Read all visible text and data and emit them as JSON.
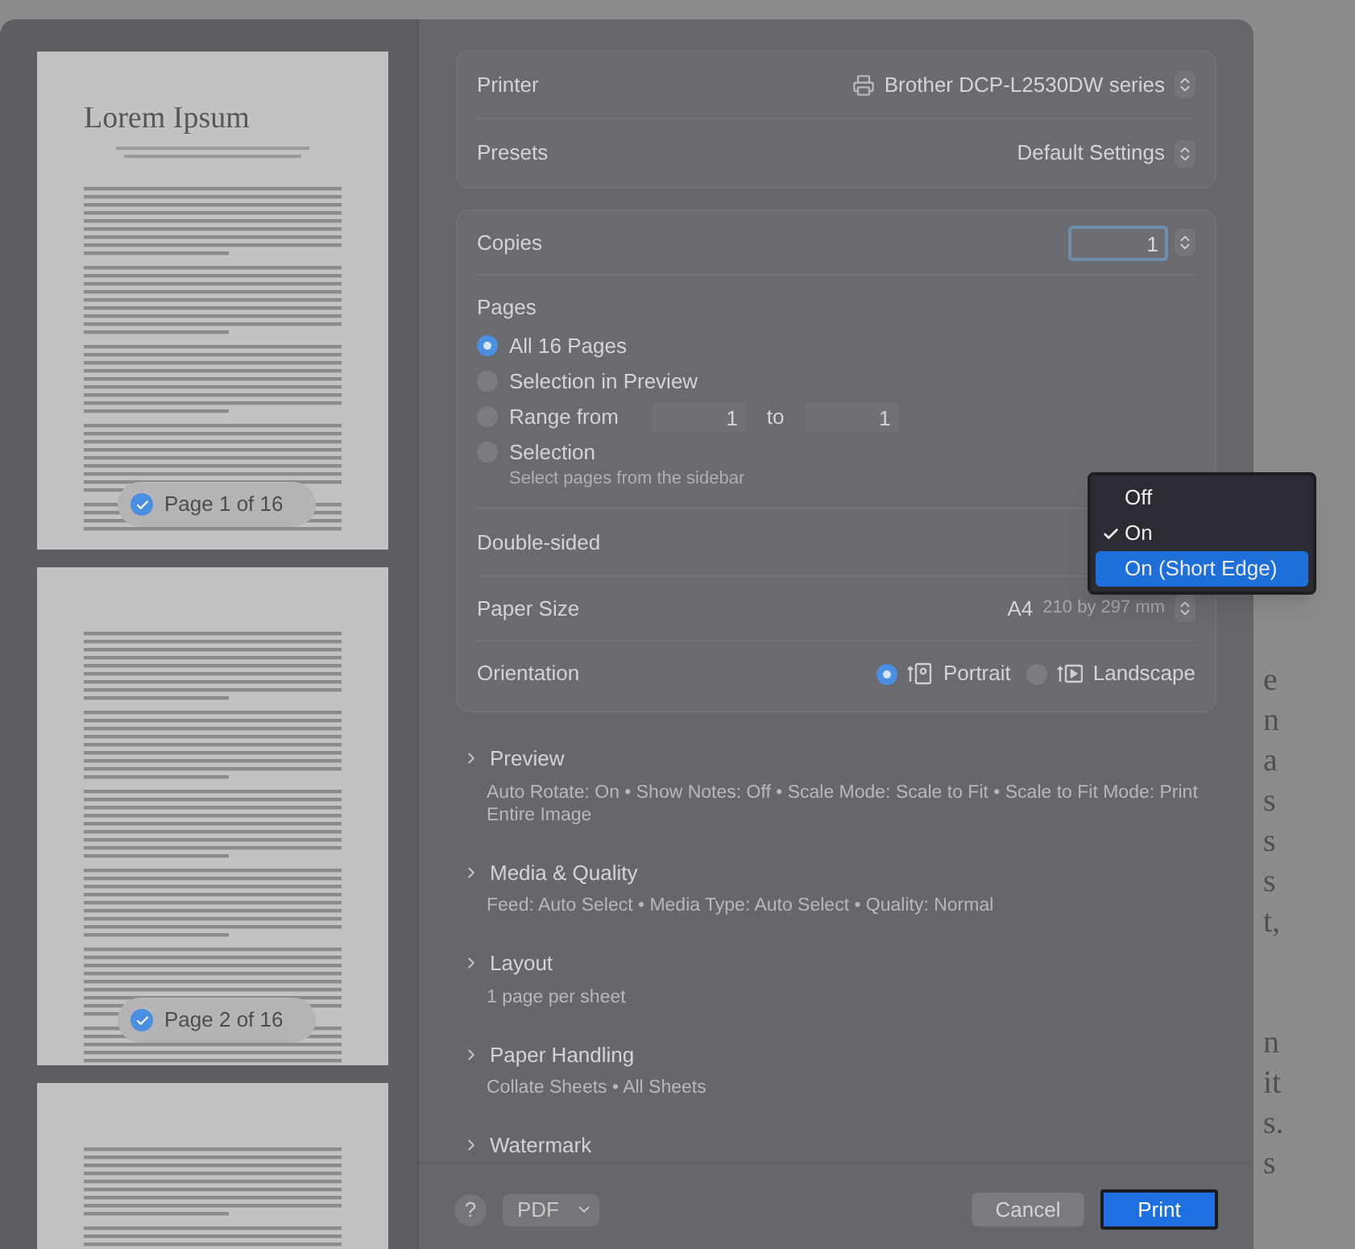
{
  "sidebar": {
    "pages": [
      {
        "kind": "page",
        "title": "Lorem Ipsum",
        "badge": "Page 1 of 16",
        "checked": true
      },
      {
        "kind": "page",
        "badge": "Page 2 of 16",
        "checked": true
      },
      {
        "kind": "page"
      }
    ]
  },
  "printer": {
    "label": "Printer",
    "value": "Brother DCP-L2530DW series"
  },
  "presets": {
    "label": "Presets",
    "value": "Default Settings"
  },
  "copies": {
    "label": "Copies",
    "value": "1"
  },
  "pages": {
    "label": "Pages",
    "options": [
      {
        "kind": "option",
        "label": "All 16 Pages",
        "selected": true
      },
      {
        "kind": "option",
        "label": "Selection in Preview",
        "selected": false
      },
      {
        "kind": "range",
        "label": "Range from",
        "from": "1",
        "to_label": "to",
        "to": "1",
        "selected": false
      },
      {
        "kind": "option",
        "label": "Selection",
        "hint": "Select pages from the sidebar",
        "selected": false
      }
    ]
  },
  "double_sided": {
    "label": "Double-sided",
    "menu": [
      {
        "label": "Off",
        "checked": false,
        "selected": false
      },
      {
        "label": "On",
        "checked": true,
        "selected": false
      },
      {
        "label": "On (Short Edge)",
        "checked": false,
        "selected": true
      }
    ]
  },
  "paper_size": {
    "label": "Paper Size",
    "value": "A4",
    "detail": "210 by 297 mm"
  },
  "orientation": {
    "label": "Orientation",
    "options": [
      {
        "kind": "portrait",
        "label": "Portrait",
        "selected": true
      },
      {
        "kind": "landscape",
        "label": "Landscape",
        "selected": false
      }
    ]
  },
  "sections": [
    {
      "title": "Preview",
      "summary": "Auto Rotate: On • Show Notes: Off • Scale Mode: Scale to Fit • Scale to Fit Mode: Print Entire Image"
    },
    {
      "title": "Media & Quality",
      "summary": "Feed: Auto Select • Media Type: Auto Select • Quality: Normal"
    },
    {
      "title": "Layout",
      "summary": "1 page per sheet"
    },
    {
      "title": "Paper Handling",
      "summary": "Collate Sheets • All Sheets"
    },
    {
      "title": "Watermark"
    }
  ],
  "footer": {
    "help": "?",
    "format": "PDF",
    "cancel": "Cancel",
    "print": "Print"
  },
  "background_text": [
    [
      "e",
      "n",
      "a",
      "s",
      "s",
      "s",
      "t,"
    ],
    [
      "n",
      "it",
      "s.",
      "s"
    ]
  ]
}
